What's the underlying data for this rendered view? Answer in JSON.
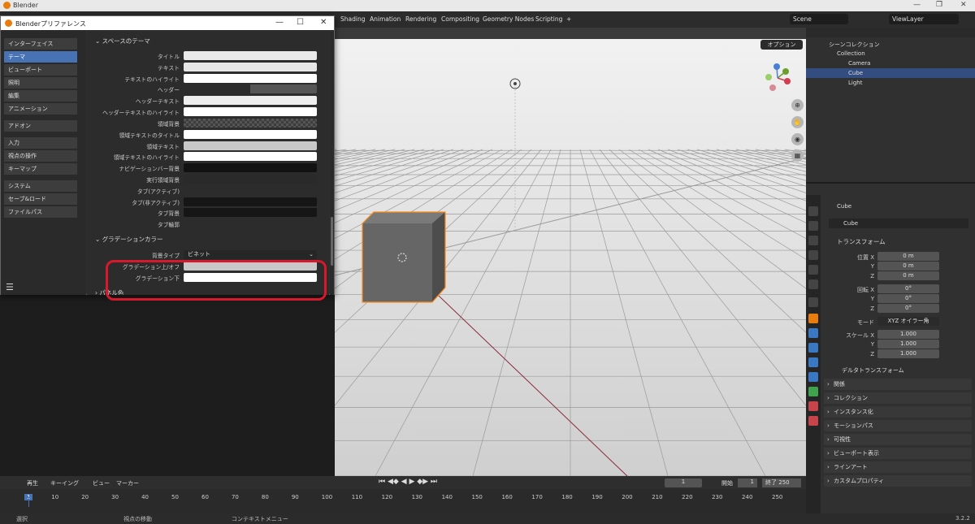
{
  "window": {
    "title": "Blender",
    "min": "—",
    "max": "❐",
    "close": "✕"
  },
  "topbar": {
    "workspaces": [
      "Shading",
      "Animation",
      "Rendering",
      "Compositing",
      "Geometry Nodes",
      "Scripting",
      "+"
    ],
    "scene": "Scene",
    "view_layer": "ViewLayer"
  },
  "viewport": {
    "options": "オプション"
  },
  "outliner": {
    "rows": [
      {
        "label": "シーンコレクション"
      },
      {
        "label": "Collection"
      },
      {
        "label": "Camera"
      },
      {
        "label": "Cube"
      },
      {
        "label": "Light"
      }
    ]
  },
  "properties": {
    "object_name": "Cube",
    "data_name": "Cube",
    "transform": "トランスフォーム",
    "loc_label": "位置 X",
    "rot_label": "回転 X",
    "scale_label": "スケール X",
    "y": "Y",
    "z": "Z",
    "loc": [
      "0 m",
      "0 m",
      "0 m"
    ],
    "rot": [
      "0°",
      "0°",
      "0°"
    ],
    "mode_label": "モード",
    "mode": "XYZ オイラー角",
    "scale": [
      "1.000",
      "1.000",
      "1.000"
    ],
    "delta": "デルタトランスフォーム",
    "sections": [
      "関係",
      "コレクション",
      "インスタンス化",
      "モーションパス",
      "可視性",
      "ビューポート表示",
      "ラインアート",
      "カスタムプロパティ"
    ]
  },
  "timeline": {
    "menus": [
      "再生",
      "キーイング",
      "ビュー",
      "マーカー"
    ],
    "current": "1",
    "start_label": "開始",
    "start": "1",
    "end_label": "終了",
    "end": "250",
    "ticks": [
      "1",
      "10",
      "20",
      "30",
      "40",
      "50",
      "60",
      "70",
      "80",
      "90",
      "100",
      "110",
      "120",
      "130",
      "140",
      "150",
      "160",
      "170",
      "180",
      "190",
      "200",
      "210",
      "220",
      "230",
      "240",
      "250"
    ]
  },
  "statusbar": {
    "select": "選択",
    "move": "視点の移動",
    "context": "コンテキストメニュー",
    "version": "3.2.2"
  },
  "prefs": {
    "title": "Blenderプリファレンス",
    "sidebar": [
      "インターフェイス",
      "テーマ",
      "ビューポート",
      "照明",
      "編集",
      "アニメーション",
      "アドオン",
      "入力",
      "視点の操作",
      "キーマップ",
      "システム",
      "セーブ&ロード",
      "ファイルパス"
    ],
    "space_theme": "スペースのテーマ",
    "rows": [
      "タイトル",
      "テキスト",
      "テキストのハイライト",
      "ヘッダー",
      "ヘッダーテキスト",
      "ヘッダーテキストのハイライト",
      "領域背景",
      "領域テキストのタイトル",
      "領域テキスト",
      "領域テキストのハイライト",
      "ナビゲーションバー背景",
      "実行領域背景",
      "タブ(アクティブ)",
      "タブ(非アクティブ)",
      "タブ背景",
      "タブ輪郭"
    ],
    "gradient_header": "グラデーションカラー",
    "bg_type_label": "背景タイプ",
    "bg_type": "ビネット",
    "grad_upper": "グラデーション上/オフ",
    "grad_lower": "グラデーション下",
    "panel_color": "パネル色"
  },
  "colors": {
    "accent": "#4772b3",
    "highlight": "#d6192c",
    "selected_outline": "#ff8c1a"
  }
}
